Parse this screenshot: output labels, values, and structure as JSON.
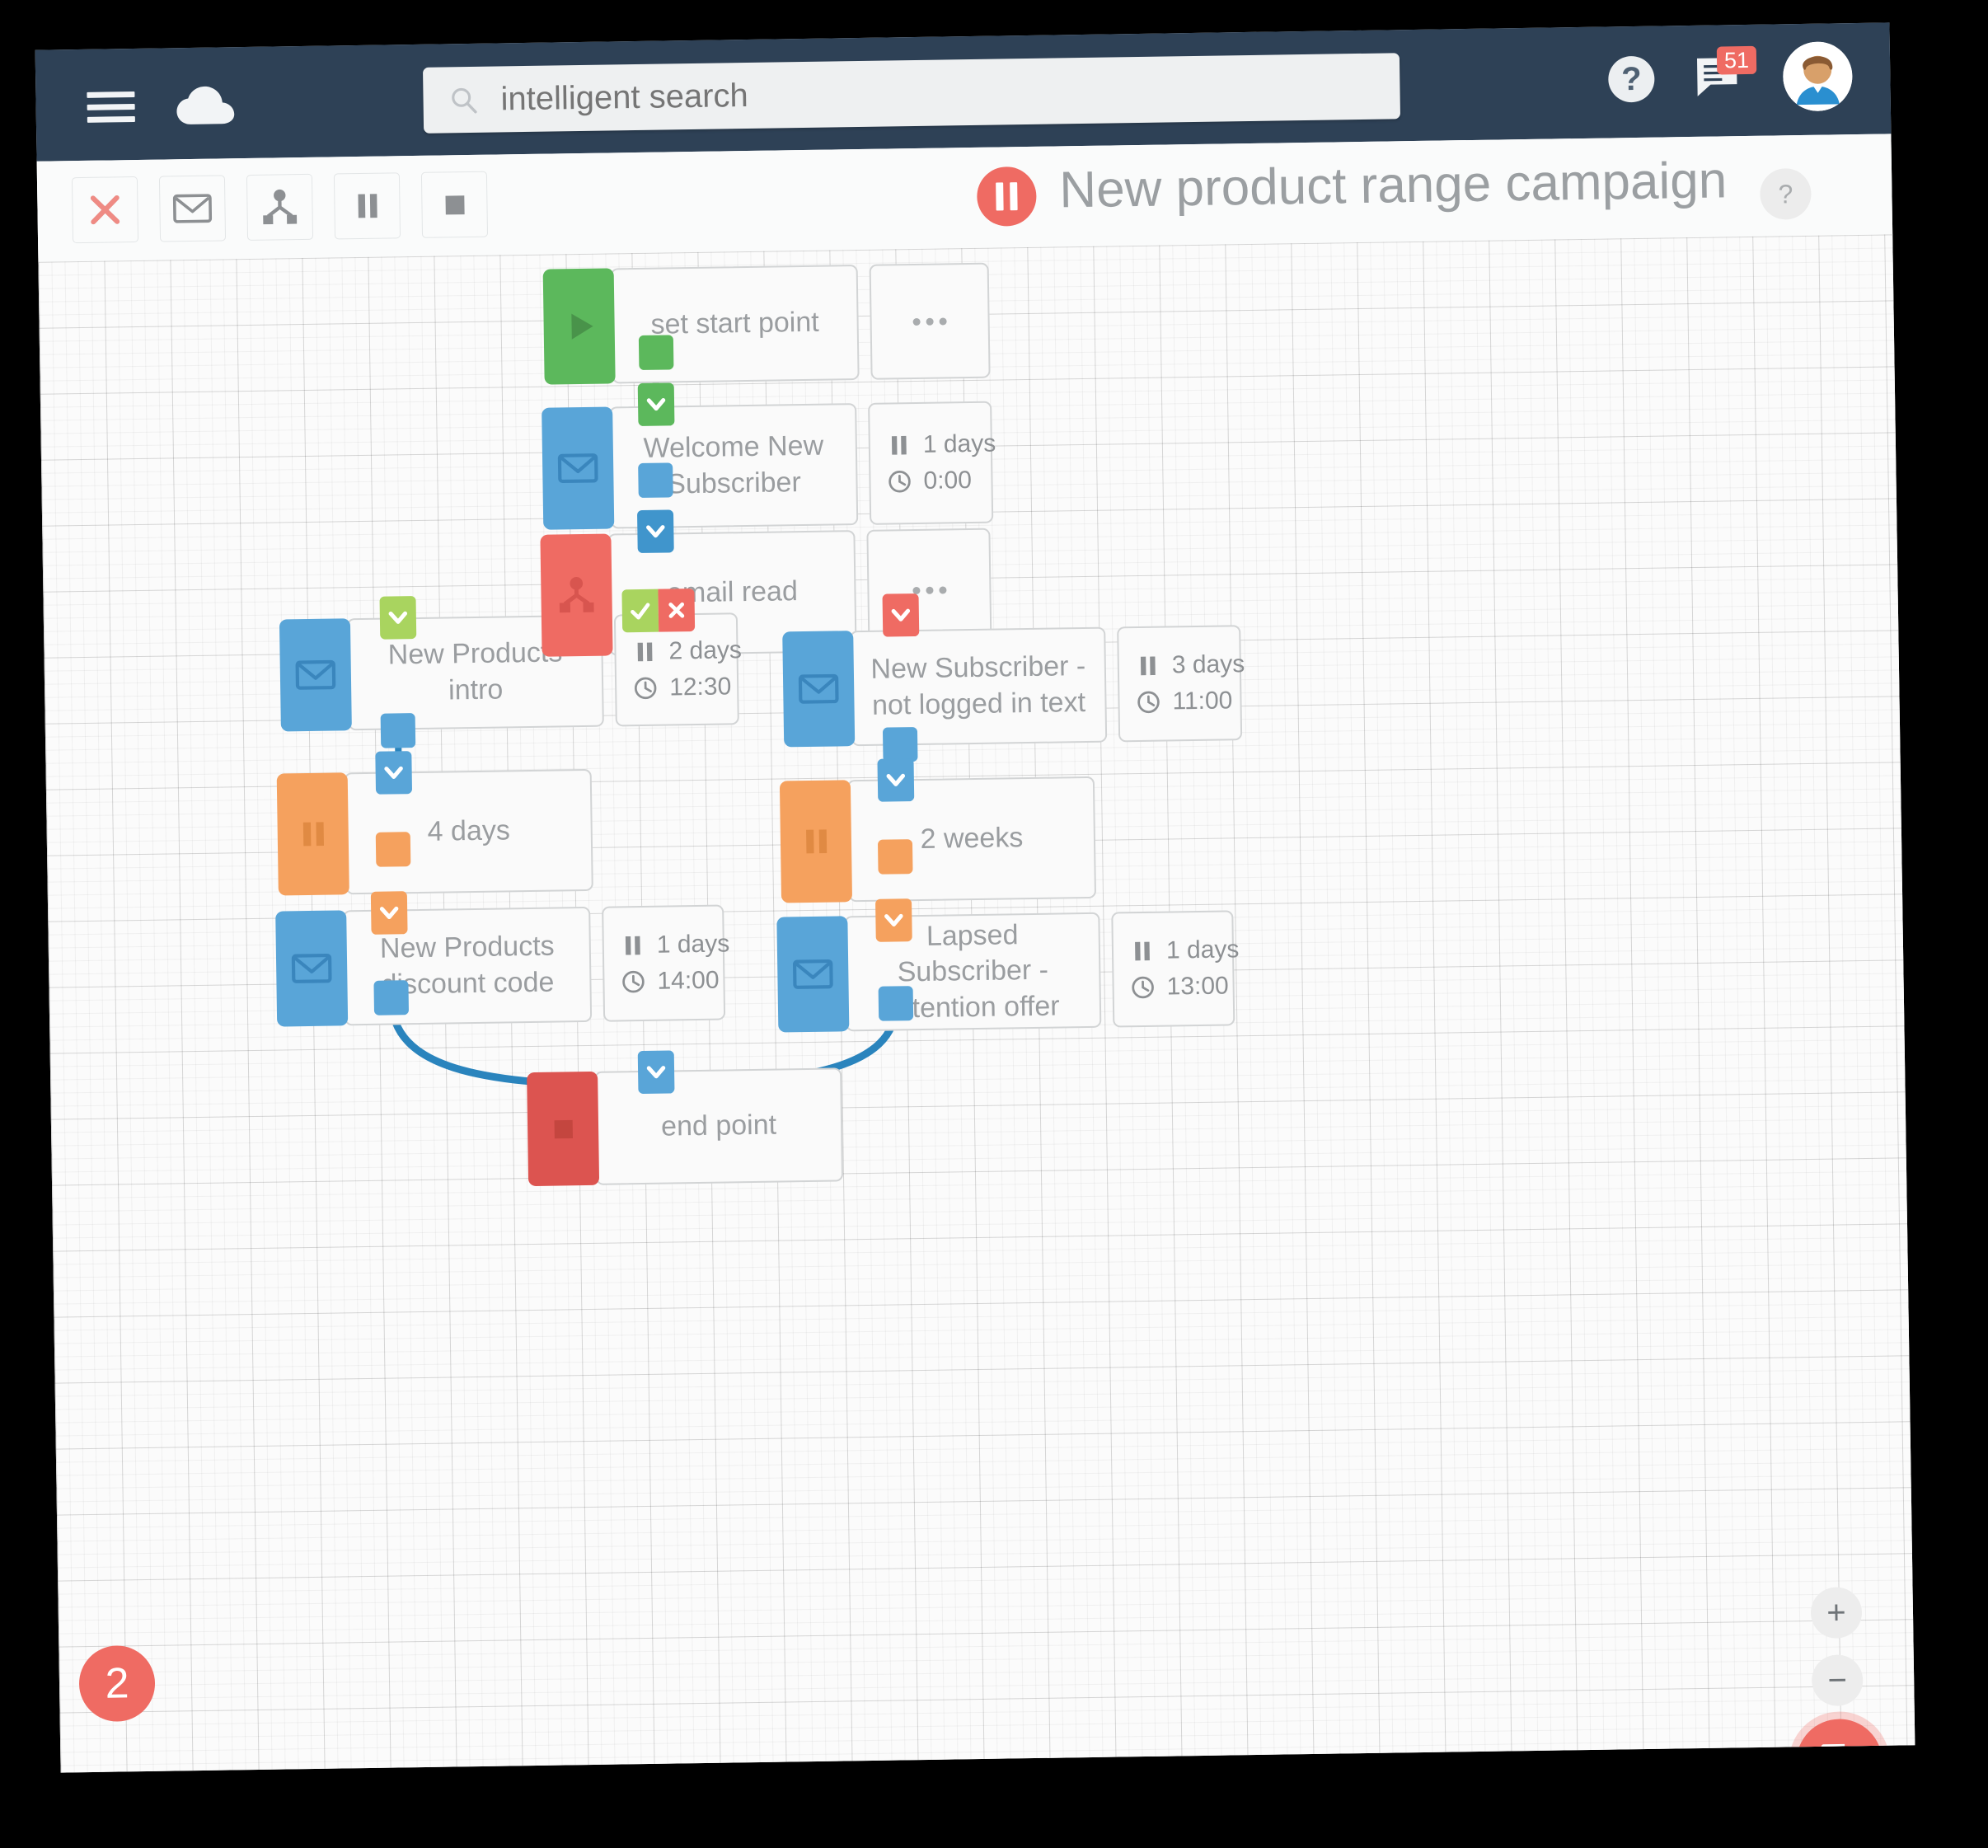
{
  "topbar": {
    "menu_icon": "hamburger-icon",
    "logo_icon": "cloud-logo-icon",
    "search": {
      "placeholder": "intelligent search",
      "value": "",
      "icon": "search-icon"
    },
    "help_label": "?",
    "messages": {
      "icon": "message-icon",
      "badge": "51"
    },
    "avatar_alt": "user-avatar"
  },
  "toolbar": {
    "buttons": [
      {
        "name": "delete-button",
        "icon": "close-x-icon"
      },
      {
        "name": "add-email-button",
        "icon": "envelope-icon"
      },
      {
        "name": "add-split-button",
        "icon": "split-branch-icon"
      },
      {
        "name": "add-wait-button",
        "icon": "pause-icon"
      },
      {
        "name": "add-end-button",
        "icon": "stop-icon"
      }
    ],
    "status_icon": "pause-icon",
    "campaign_title": "New product range campaign",
    "title_help_label": "?"
  },
  "canvas": {
    "nodes": [
      {
        "id": "start",
        "type": "start",
        "label": "set start point",
        "aux": "dots"
      },
      {
        "id": "welcome",
        "type": "email",
        "label": "Welcome New\nSubscriber",
        "aux": {
          "days": "1 days",
          "time": "0:00"
        }
      },
      {
        "id": "emailread",
        "type": "split",
        "label": "email read",
        "aux": "dots"
      },
      {
        "id": "intro",
        "type": "email",
        "label": "New Products intro",
        "aux": {
          "days": "2 days",
          "time": "12:30"
        }
      },
      {
        "id": "notlogged",
        "type": "email",
        "label": "New Subscriber -\nnot logged in text",
        "aux": {
          "days": "3 days",
          "time": "11:00"
        }
      },
      {
        "id": "wait4",
        "type": "wait",
        "label": "4 days",
        "aux": null
      },
      {
        "id": "wait2w",
        "type": "wait",
        "label": "2 weeks",
        "aux": null
      },
      {
        "id": "discount",
        "type": "email",
        "label": "New Products\ndiscount code",
        "aux": {
          "days": "1 days",
          "time": "14:00"
        }
      },
      {
        "id": "retention",
        "type": "email",
        "label": "Lapsed Subscriber -\nretention offer",
        "aux": {
          "days": "1 days",
          "time": "13:00"
        }
      },
      {
        "id": "end",
        "type": "end",
        "label": "end point",
        "aux": null
      }
    ],
    "branch_labels": {
      "yes": "check-icon",
      "no": "close-x-icon"
    },
    "zoom_in_label": "+",
    "zoom_out_label": "−",
    "step_badge": "2",
    "fab_icon": "exit-arrow-icon"
  },
  "colors": {
    "navbar": "#2e4156",
    "green": "#5cb85c",
    "blue": "#59a5d8",
    "red": "#ef6b63",
    "orange": "#f5a15e",
    "lime": "#a9d45f",
    "end_red": "#dc5450",
    "card_border": "#d2d4d5",
    "text": "#9a9da0"
  }
}
